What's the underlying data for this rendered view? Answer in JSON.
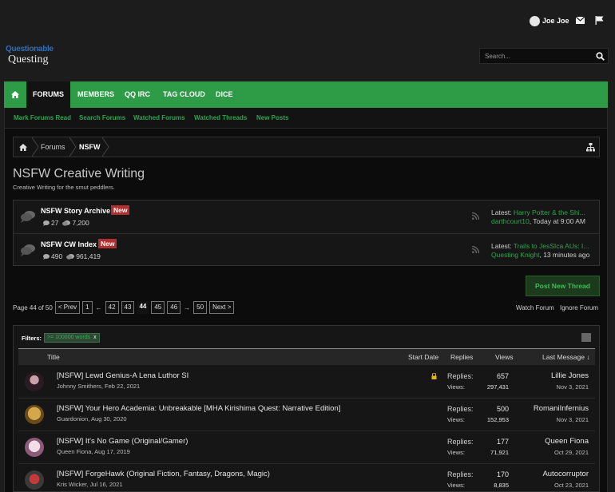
{
  "header": {
    "user_name": "Joe Joe",
    "logo_line1": "Questionable",
    "logo_line2": "Questing",
    "search_placeholder": "Search..."
  },
  "nav": {
    "tabs": [
      "FORUMS",
      "MEMBERS",
      "QQ IRC",
      "TAG CLOUD",
      "DICE"
    ],
    "sub_links": [
      "Mark Forums Read",
      "Search Forums",
      "Watched Forums",
      "Watched Threads",
      "New Posts"
    ]
  },
  "breadcrumb": [
    "Forums",
    "NSFW"
  ],
  "page": {
    "title": "NSFW Creative Writing",
    "description": "Creative Writing for the smut peddlers."
  },
  "subforums": [
    {
      "title": "NSFW Story Archive",
      "badge": "New",
      "threads": "27",
      "messages": "7,200",
      "latest_label": "Latest:",
      "latest_title": "Harry Potter & the Shi...",
      "latest_user": "darthcourt10",
      "latest_time": ", Today at 9:00 AM"
    },
    {
      "title": "NSFW CW Index",
      "badge": "New",
      "threads": "490",
      "messages": "961,419",
      "latest_label": "Latest:",
      "latest_title": "Trails to JesSIca AUs: I...",
      "latest_user": "Questing Knight",
      "latest_time": ", 13 minutes ago"
    }
  ],
  "actions": {
    "post_new_thread": "Post New Thread",
    "watch_forum": "Watch Forum",
    "ignore_forum": "Ignore Forum"
  },
  "pagination": {
    "label": "Page 44 of 50",
    "prev": "< Prev",
    "first": "1",
    "pages_before": [
      "42",
      "43"
    ],
    "current": "44",
    "pages_after": [
      "45",
      "46"
    ],
    "last": "50",
    "next": "Next >",
    "arrow_left": "←",
    "arrow_right": "→"
  },
  "filters": {
    "label": "Filters:",
    "chip": ">= 100000 words",
    "chip_remove": "x"
  },
  "table": {
    "headers": [
      "Title",
      "Start Date",
      "Replies",
      "Views",
      "Last Message ↓"
    ],
    "replies_label": "Replies:",
    "views_label": "Views:",
    "rows": [
      {
        "title": "[NSFW] Lewd Genius-A Lena Luthor SI",
        "author_date": "Johnny Smithers, Feb 22, 2021",
        "replies": "657",
        "views": "297,431",
        "last_user": "Lillie Jones",
        "last_date": "Nov 3, 2021",
        "locked": true,
        "avatar_color": "#5a3a4a"
      },
      {
        "title": "[NSFW] Your Hero Academia: Unbreakable [MHA Kirishima Quest: Narrative Edition]",
        "author_date": "Guardonion, Aug 30, 2020",
        "replies": "500",
        "views": "152,953",
        "last_user": "RomaniInfernius",
        "last_date": "Nov 3, 2021",
        "locked": false,
        "avatar_color": "#a07a30"
      },
      {
        "title": "[NSFW] It's No Game (Original/Gamer)",
        "author_date": "Queen Fiona, Aug 17, 2019",
        "replies": "177",
        "views": "71,921",
        "last_user": "Queen Fiona",
        "last_date": "Oct 29, 2021",
        "locked": false,
        "avatar_color": "#d9c9d9"
      },
      {
        "title": "[NSFW] ForgeHawk (Original Fiction, Fantasy, Dragons, Magic)",
        "author_date": "Kris Wicker, Jul 16, 2021",
        "replies": "170",
        "views": "8,835",
        "last_user": "Autocorruptor",
        "last_date": "Oct 23, 2021",
        "locked": false,
        "avatar_color": "#7a2a2a"
      }
    ]
  },
  "colors": {
    "accent_green": "#2e9b46",
    "link_green": "#2ea44f",
    "badge_red": "#b0302f"
  }
}
